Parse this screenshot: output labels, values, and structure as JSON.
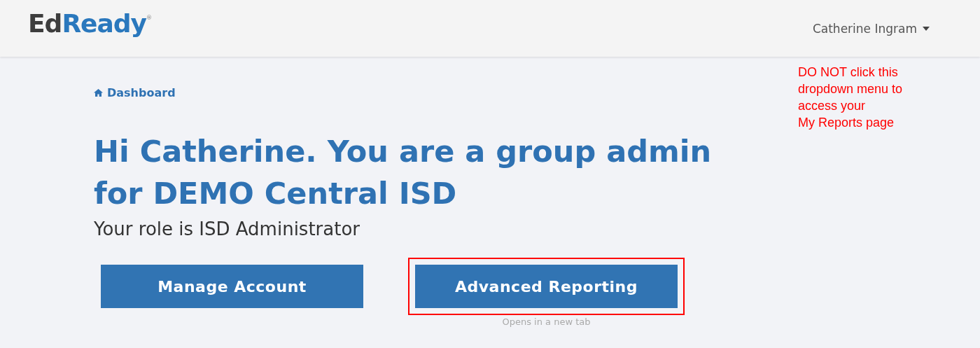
{
  "header": {
    "logo": {
      "dark": "Ed",
      "accent": "Ready",
      "mark": "®"
    },
    "user_menu": {
      "label": "Catherine Ingram"
    }
  },
  "annotation": {
    "lines": [
      "DO NOT click this",
      "dropdown menu to",
      "access your",
      "My Reports page"
    ]
  },
  "breadcrumb": {
    "label": "Dashboard"
  },
  "heading": "Hi Catherine. You are a group admin for DEMO Central ISD",
  "subheading": "Your role is ISD Administrator",
  "buttons": [
    {
      "label": "Manage Account",
      "highlighted": false
    },
    {
      "label": "Advanced Reporting",
      "highlighted": true,
      "note": "Opens in a new tab"
    }
  ]
}
